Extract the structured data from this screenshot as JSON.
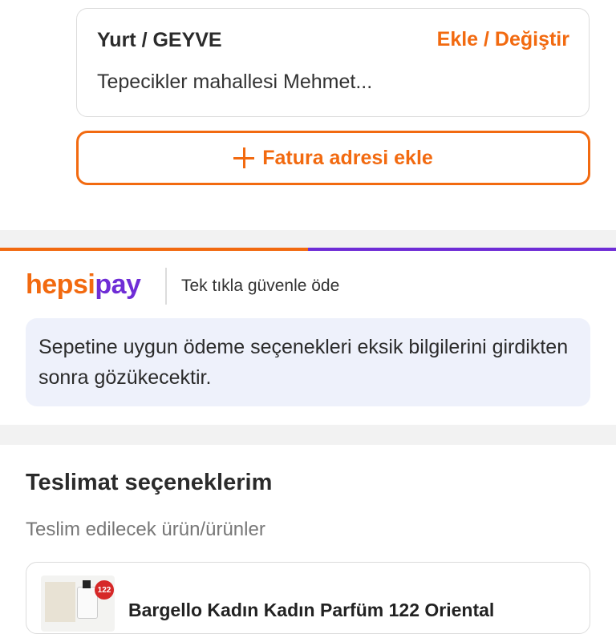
{
  "address": {
    "title": "Yurt / GEYVE",
    "action_label": "Ekle / Değiştir",
    "detail": "Tepecikler mahallesi Mehmet..."
  },
  "invoice_button": {
    "label": "Fatura adresi ekle",
    "icon": "plus-icon"
  },
  "payment": {
    "logo_part1": "hepsi",
    "logo_part2": "pay",
    "tagline": "Tek tıkla güvenle öde",
    "info_text": "Sepetine uygun ödeme seçenekleri eksik bilgilerini girdikten sonra gözükecektir."
  },
  "delivery": {
    "title": "Teslimat seçeneklerim",
    "subtitle": "Teslim edilecek ürün/ürünler",
    "product": {
      "name": "Bargello Kadın Kadın Parfüm 122 Oriental",
      "badge": "122"
    }
  },
  "colors": {
    "accent": "#f26a10",
    "brand_purple": "#6f2dd6",
    "info_bg": "#eef1fb"
  }
}
